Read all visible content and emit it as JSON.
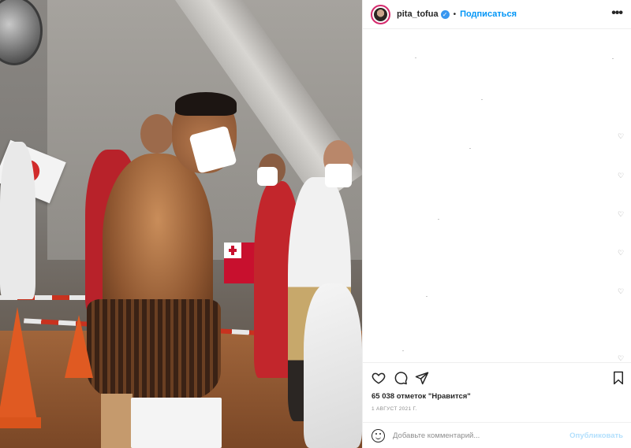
{
  "post": {
    "username": "pita_tofua",
    "verified_icon": "verified-badge-icon",
    "follow_separator": "•",
    "follow_label": "Подписаться",
    "more_icon": "more-options-icon",
    "more_glyph": "•••"
  },
  "photo": {
    "description_icon": "photo"
  },
  "comments": {
    "like_icon": "heart-outline-icon",
    "heart_glyph": "♡"
  },
  "actions": {
    "like_icon": "heart-icon",
    "comment_icon": "comment-icon",
    "share_icon": "share-icon",
    "save_icon": "bookmark-icon",
    "likes_text": "65 038 отметок \"Нравится\"",
    "date": "1 АВГУСТ 2021 Г."
  },
  "comment_box": {
    "emoji_icon": "emoji-icon",
    "placeholder": "Добавьте комментарий...",
    "publish_label": "Опубликовать"
  }
}
